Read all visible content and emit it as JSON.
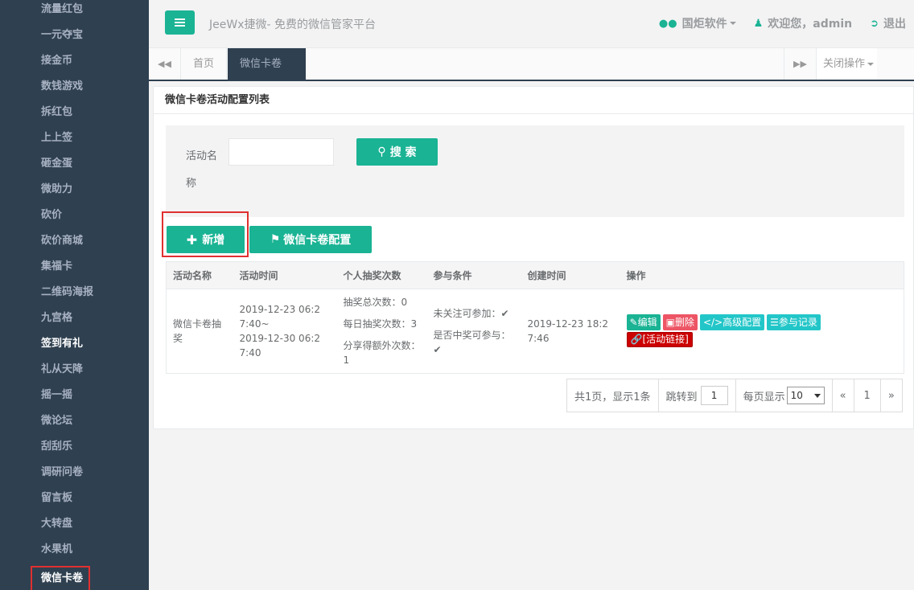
{
  "sidebar": {
    "items": [
      {
        "label": "流量红包",
        "state": "normal"
      },
      {
        "label": "一元夺宝",
        "state": "normal"
      },
      {
        "label": "接金币",
        "state": "normal"
      },
      {
        "label": "数钱游戏",
        "state": "normal"
      },
      {
        "label": "拆红包",
        "state": "normal"
      },
      {
        "label": "上上签",
        "state": "normal"
      },
      {
        "label": "砸金蛋",
        "state": "normal"
      },
      {
        "label": "微助力",
        "state": "normal"
      },
      {
        "label": "砍价",
        "state": "normal"
      },
      {
        "label": "砍价商城",
        "state": "normal"
      },
      {
        "label": "集福卡",
        "state": "normal"
      },
      {
        "label": "二维码海报",
        "state": "normal"
      },
      {
        "label": "九宫格",
        "state": "normal"
      },
      {
        "label": "签到有礼",
        "state": "bright"
      },
      {
        "label": "礼从天降",
        "state": "normal"
      },
      {
        "label": "摇一摇",
        "state": "normal"
      },
      {
        "label": "微论坛",
        "state": "normal"
      },
      {
        "label": "刮刮乐",
        "state": "normal"
      },
      {
        "label": "调研问卷",
        "state": "normal"
      },
      {
        "label": "留言板",
        "state": "normal"
      },
      {
        "label": "大转盘",
        "state": "normal"
      },
      {
        "label": "水果机",
        "state": "normal"
      },
      {
        "label": "微信卡卷",
        "state": "active"
      }
    ]
  },
  "header": {
    "brand": "JeeWx捷微- 免费的微信管家平台",
    "software": "国炬软件",
    "welcome": "欢迎您，admin",
    "logout": "退出"
  },
  "tabs": {
    "home": "首页",
    "current": "微信卡卷",
    "close_ops": "关闭操作"
  },
  "panel": {
    "title": "微信卡卷活动配置列表",
    "search_label": "活动名称",
    "search_value": "",
    "search_button": "搜 索",
    "add_button": "新增",
    "config_button": "微信卡卷配置"
  },
  "table": {
    "headers": [
      "活动名称",
      "活动时间",
      "个人抽奖次数",
      "参与条件",
      "创建时间",
      "操作"
    ],
    "rows": [
      {
        "name": "微信卡卷抽奖",
        "time_start": "2019-12-23 06:27:40~",
        "time_end": "2019-12-30 06:27:40",
        "total_draws": "抽奖总次数：0",
        "daily_draws": "每日抽奖次数：3",
        "share_draws": "分享得额外次数：1",
        "cond_follow": "未关注可参加：",
        "cond_winner": "是否中奖可参与：",
        "created": "2019-12-23 18:27:46",
        "ops": {
          "edit": "编辑",
          "delete": "删除",
          "advanced": "高级配置",
          "records": "参与记录",
          "link": "[活动链接]"
        }
      }
    ]
  },
  "pager": {
    "summary": "共1页，显示1条",
    "jump_label": "跳转到",
    "jump_value": "1",
    "per_page_label": "每页显示",
    "per_page_value": "10",
    "prev": "«",
    "page": "1",
    "next": "»"
  },
  "colors": {
    "sidebar_bg": "#2f4050",
    "accent": "#1ab394",
    "highlight": "#e0302f"
  }
}
